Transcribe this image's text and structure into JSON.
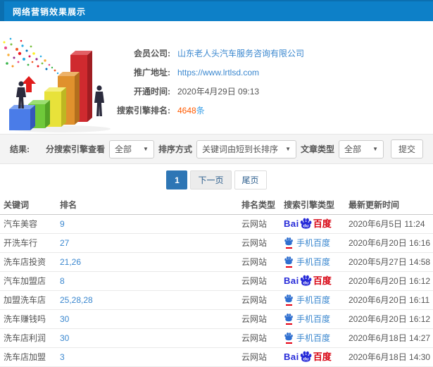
{
  "header": {
    "title": "网络营销效果展示"
  },
  "colors": {
    "topbar_blue": "#0d80c8",
    "link_blue": "#3a87cf",
    "highlight_orange": "#ff5a00",
    "active_page_blue": "#2e76b5",
    "baidu_blue": "#2529d8",
    "baidu_red": "#d7000f"
  },
  "info": {
    "rows": [
      {
        "label": "会员公司:",
        "value": "山东老人头汽车服务咨询有限公司"
      },
      {
        "label": "推广地址:",
        "value": "https://www.lrtlsd.com"
      },
      {
        "label": "开通时间:",
        "value": "2020年4月29日 09:13"
      },
      {
        "label": "搜索引擎排名:",
        "value": "4648",
        "suffix": "条"
      }
    ]
  },
  "filters": {
    "result_label": "结果:",
    "engine_filter_label": "分搜索引擎查看",
    "engine_filter_value": "全部",
    "sort_label": "排序方式",
    "sort_value": "关键词由短到长排序",
    "article_type_label": "文章类型",
    "article_type_value": "全部",
    "submit_label": "提交",
    "caret": "▼"
  },
  "pagination": {
    "current": "1",
    "next": "下一页",
    "last": "尾页"
  },
  "table": {
    "headers": [
      "关键词",
      "排名",
      "排名类型",
      "搜索引擎类型",
      "最新更新时间"
    ],
    "baidu_logo": {
      "bai": "Bai",
      "du": "du",
      "cn": "百度",
      "mobile": "手机百度"
    },
    "rows": [
      {
        "keyword": "汽车美容",
        "rank": "9",
        "rank_type": "云网站",
        "engine": "baidu",
        "updated": "2020年6月5日 11:24"
      },
      {
        "keyword": "开洗车行",
        "rank": "27",
        "rank_type": "云网站",
        "engine": "mobile-baidu",
        "updated": "2020年6月20日 16:16"
      },
      {
        "keyword": "洗车店投资",
        "rank": "21,26",
        "rank_type": "云网站",
        "engine": "mobile-baidu",
        "updated": "2020年5月27日 14:58"
      },
      {
        "keyword": "汽车加盟店",
        "rank": "8",
        "rank_type": "云网站",
        "engine": "baidu",
        "updated": "2020年6月20日 16:12"
      },
      {
        "keyword": "加盟洗车店",
        "rank": "25,28,28",
        "rank_type": "云网站",
        "engine": "mobile-baidu",
        "updated": "2020年6月20日 16:11"
      },
      {
        "keyword": "洗车赚钱吗",
        "rank": "30",
        "rank_type": "云网站",
        "engine": "mobile-baidu",
        "updated": "2020年6月20日 16:12"
      },
      {
        "keyword": "洗车店利润",
        "rank": "30",
        "rank_type": "云网站",
        "engine": "mobile-baidu",
        "updated": "2020年6月18日 14:27"
      },
      {
        "keyword": "洗车店加盟",
        "rank": "3",
        "rank_type": "云网站",
        "engine": "baidu",
        "updated": "2020年6月18日 14:30"
      }
    ]
  }
}
